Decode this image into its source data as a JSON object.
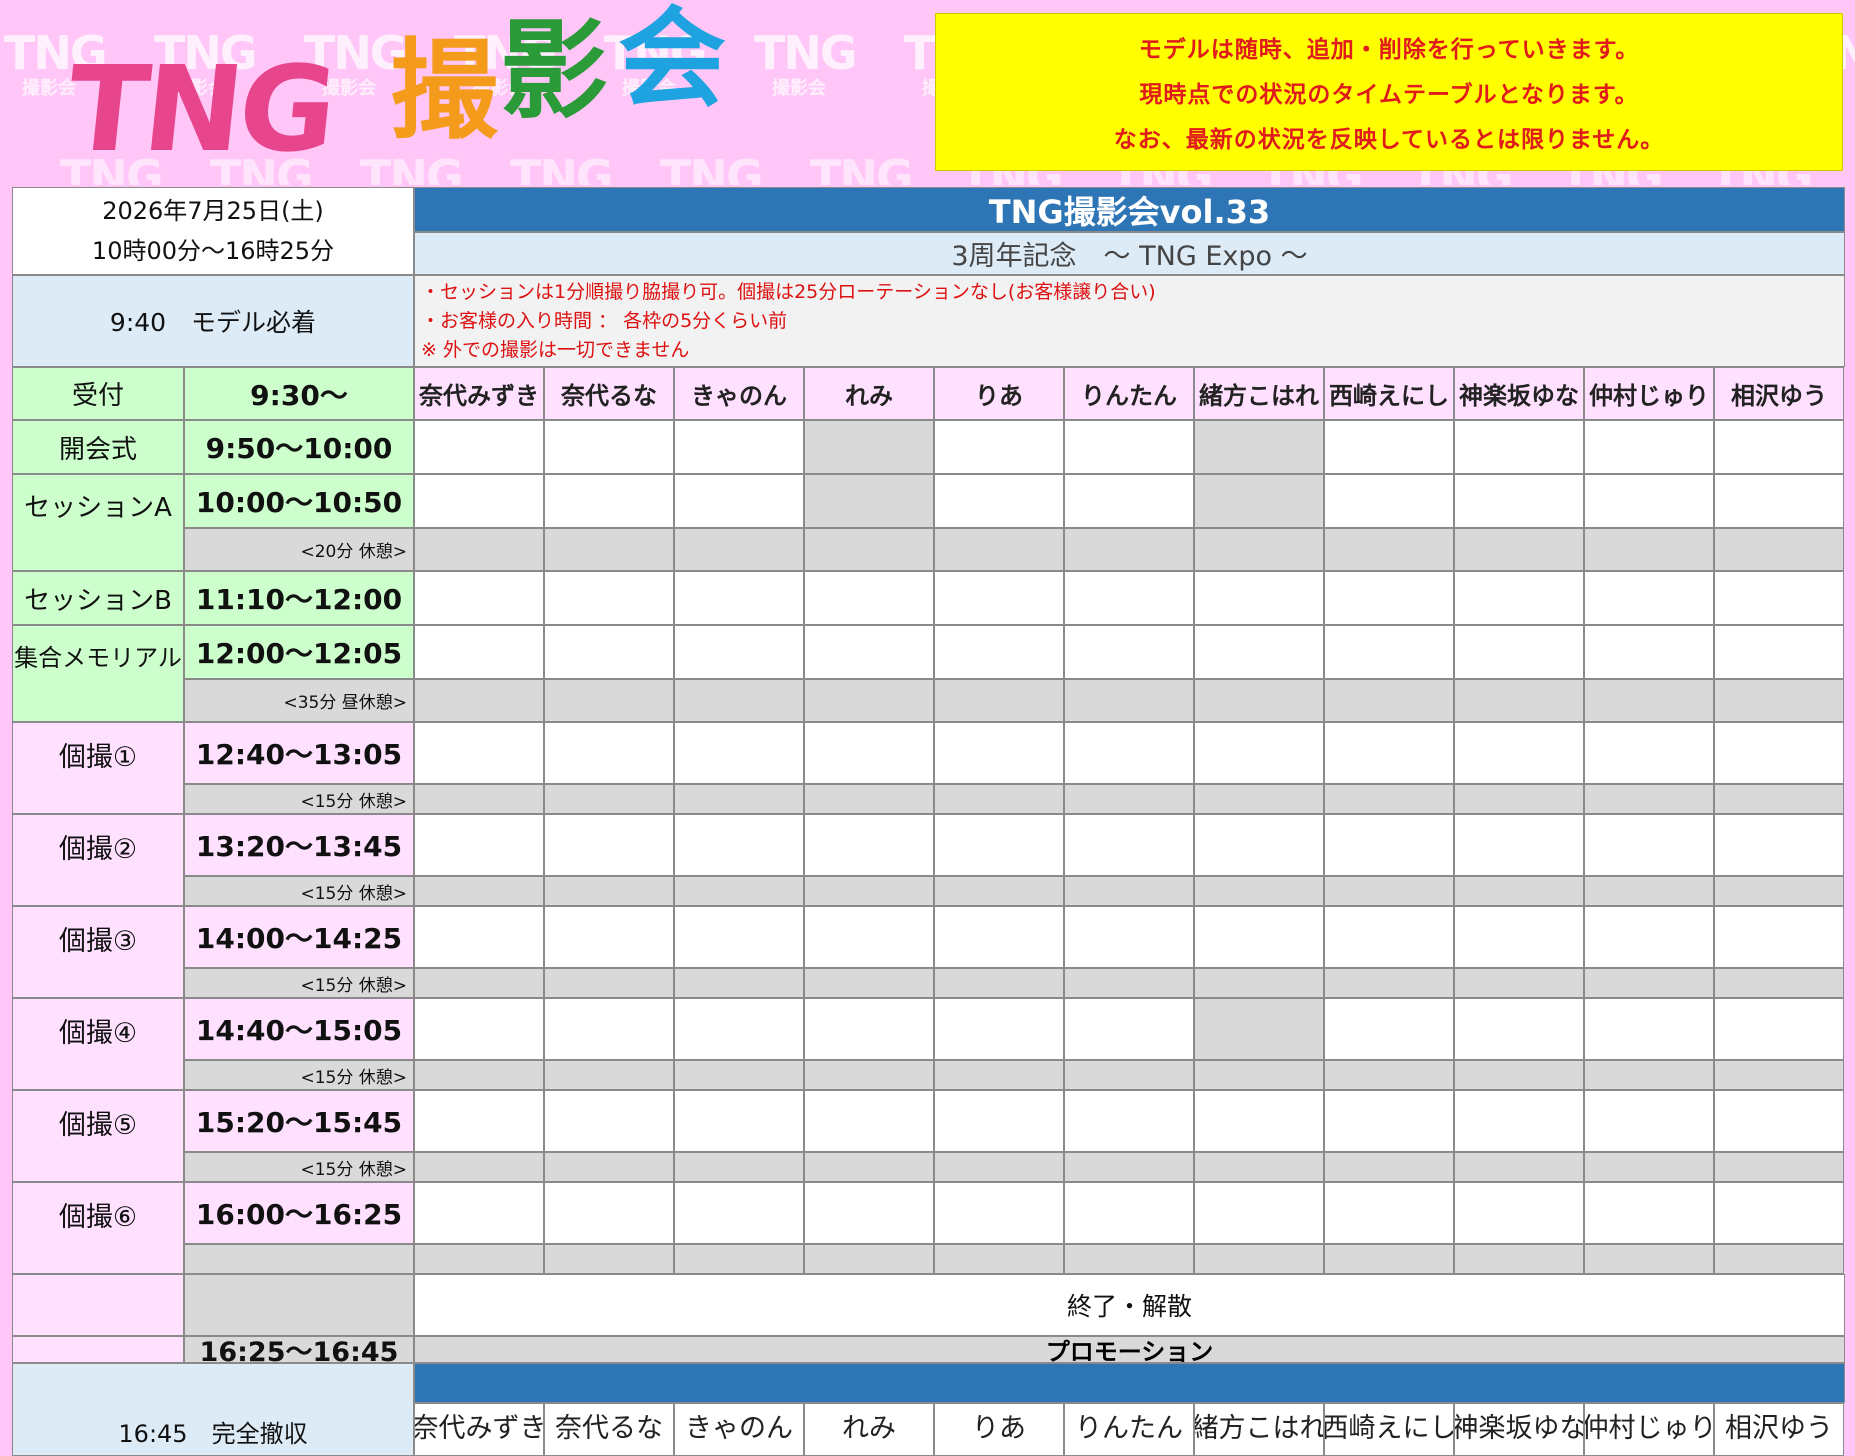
{
  "header": {
    "logo_latin": "TNG",
    "logo_kanji": [
      "撮",
      "影",
      "会"
    ],
    "watermark_text": "TNG",
    "watermark_sub": "撮影会",
    "notice_lines": [
      "モデルは随時、追加・削除を行っていきます。",
      "現時点での状況のタイムテーブルとなります。",
      "なお、最新の状況を反映しているとは限りません。"
    ]
  },
  "event": {
    "date": "2026年7月25日(土)",
    "hours": "10時00分～16時25分",
    "title": "TNG撮影会vol.33",
    "subtitle": "3周年記念　～ TNG Expo ～",
    "model_arrival": "9:40　モデル必着",
    "rules": [
      "・セッションは1分順撮り脇撮り可。個撮は25分ローテーションなし(お客様譲り合い)",
      "・お客様の入り時間 ： 各枠の5分くらい前",
      "※ 外での撮影は一切できません"
    ]
  },
  "colors": {
    "title_bar": "#2e75b6",
    "subtitle_bar": "#ddebf7",
    "green": "#ccffcc",
    "pink": "#ffe1ff",
    "grey": "#d9d9d9",
    "notice_bg": "#ffff00",
    "notice_text": "#e01b1b"
  },
  "models": [
    "奈代みずき",
    "奈代るな",
    "きゃのん",
    "れみ",
    "りあ",
    "りんたん",
    "緒方こはれ",
    "西崎えにし",
    "神楽坂ゆな",
    "仲村じゅり",
    "相沢ゆう"
  ],
  "schedule": {
    "reception": {
      "label": "受付",
      "time": "9:30～"
    },
    "opening": {
      "label": "開会式",
      "time": "9:50～10:00"
    },
    "session_a": {
      "label": "セッションA",
      "time": "10:00～10:50",
      "break": "<20分 休憩>"
    },
    "session_b": {
      "label": "セッションB",
      "time": "11:10～12:00"
    },
    "memorial": {
      "label": "集合メモリアル",
      "time": "12:00～12:05",
      "break": "<35分 昼休憩>"
    },
    "kosatsu": [
      {
        "label": "個撮①",
        "time": "12:40～13:05",
        "break": "<15分 休憩>"
      },
      {
        "label": "個撮②",
        "time": "13:20～13:45",
        "break": "<15分 休憩>"
      },
      {
        "label": "個撮③",
        "time": "14:00～14:25",
        "break": "<15分 休憩>"
      },
      {
        "label": "個撮④",
        "time": "14:40～15:05",
        "break": "<15分 休憩>"
      },
      {
        "label": "個撮⑤",
        "time": "15:20～15:45",
        "break": "<15分 休憩>"
      },
      {
        "label": "個撮⑥",
        "time": "16:00～16:25",
        "break": ""
      }
    ],
    "end": "終了・解散",
    "promo_time": "16:25～16:45",
    "promo_label": "プロモーション",
    "teardown": "16:45　完全撤収"
  }
}
